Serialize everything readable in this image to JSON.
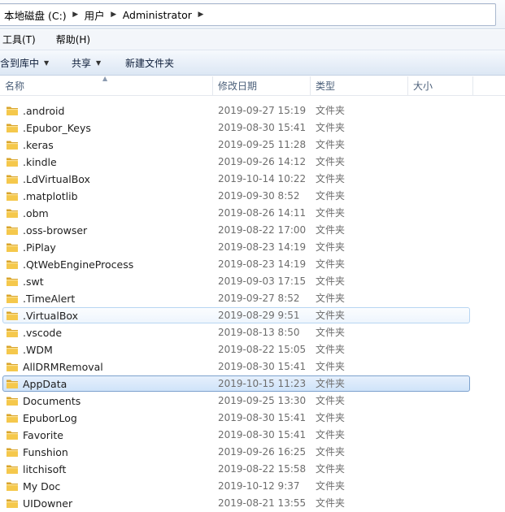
{
  "breadcrumb": [
    "本地磁盘 (C:)",
    "用户",
    "Administrator"
  ],
  "menu": [
    "工具(T)",
    "帮助(H)"
  ],
  "toolbar": {
    "include_in_library": "含到库中",
    "share": "共享",
    "new_folder": "新建文件夹"
  },
  "columns": {
    "name": "名称",
    "date": "修改日期",
    "type": "类型",
    "size": "大小"
  },
  "colors": {
    "folder_yellow": "#f5c84c",
    "folder_dark": "#d9a52c",
    "selection_border": "#7da2ce",
    "hover_border": "#b8d6f2"
  },
  "files": [
    {
      "name": ".android",
      "date": "2019-09-27 15:19",
      "type": "文件夹",
      "state": ""
    },
    {
      "name": ".Epubor_Keys",
      "date": "2019-08-30 15:41",
      "type": "文件夹",
      "state": ""
    },
    {
      "name": ".keras",
      "date": "2019-09-25 11:28",
      "type": "文件夹",
      "state": ""
    },
    {
      "name": ".kindle",
      "date": "2019-09-26 14:12",
      "type": "文件夹",
      "state": ""
    },
    {
      "name": ".LdVirtualBox",
      "date": "2019-10-14 10:22",
      "type": "文件夹",
      "state": ""
    },
    {
      "name": ".matplotlib",
      "date": "2019-09-30 8:52",
      "type": "文件夹",
      "state": ""
    },
    {
      "name": ".obm",
      "date": "2019-08-26 14:11",
      "type": "文件夹",
      "state": ""
    },
    {
      "name": ".oss-browser",
      "date": "2019-08-22 17:00",
      "type": "文件夹",
      "state": ""
    },
    {
      "name": ".PiPlay",
      "date": "2019-08-23 14:19",
      "type": "文件夹",
      "state": ""
    },
    {
      "name": ".QtWebEngineProcess",
      "date": "2019-08-23 14:19",
      "type": "文件夹",
      "state": ""
    },
    {
      "name": ".swt",
      "date": "2019-09-03 17:15",
      "type": "文件夹",
      "state": ""
    },
    {
      "name": ".TimeAlert",
      "date": "2019-09-27 8:52",
      "type": "文件夹",
      "state": ""
    },
    {
      "name": ".VirtualBox",
      "date": "2019-08-29 9:51",
      "type": "文件夹",
      "state": "hover"
    },
    {
      "name": ".vscode",
      "date": "2019-08-13 8:50",
      "type": "文件夹",
      "state": ""
    },
    {
      "name": ".WDM",
      "date": "2019-08-22 15:05",
      "type": "文件夹",
      "state": ""
    },
    {
      "name": "AllDRMRemoval",
      "date": "2019-08-30 15:41",
      "type": "文件夹",
      "state": ""
    },
    {
      "name": "AppData",
      "date": "2019-10-15 11:23",
      "type": "文件夹",
      "state": "selected"
    },
    {
      "name": "Documents",
      "date": "2019-09-25 13:30",
      "type": "文件夹",
      "state": ""
    },
    {
      "name": "EpuborLog",
      "date": "2019-08-30 15:41",
      "type": "文件夹",
      "state": ""
    },
    {
      "name": "Favorite",
      "date": "2019-08-30 15:41",
      "type": "文件夹",
      "state": ""
    },
    {
      "name": "Funshion",
      "date": "2019-09-26 16:25",
      "type": "文件夹",
      "state": ""
    },
    {
      "name": "litchisoft",
      "date": "2019-08-22 15:58",
      "type": "文件夹",
      "state": ""
    },
    {
      "name": "My Doc",
      "date": "2019-10-12 9:37",
      "type": "文件夹",
      "state": ""
    },
    {
      "name": "UIDowner",
      "date": "2019-08-21 13:55",
      "type": "文件夹",
      "state": ""
    }
  ]
}
